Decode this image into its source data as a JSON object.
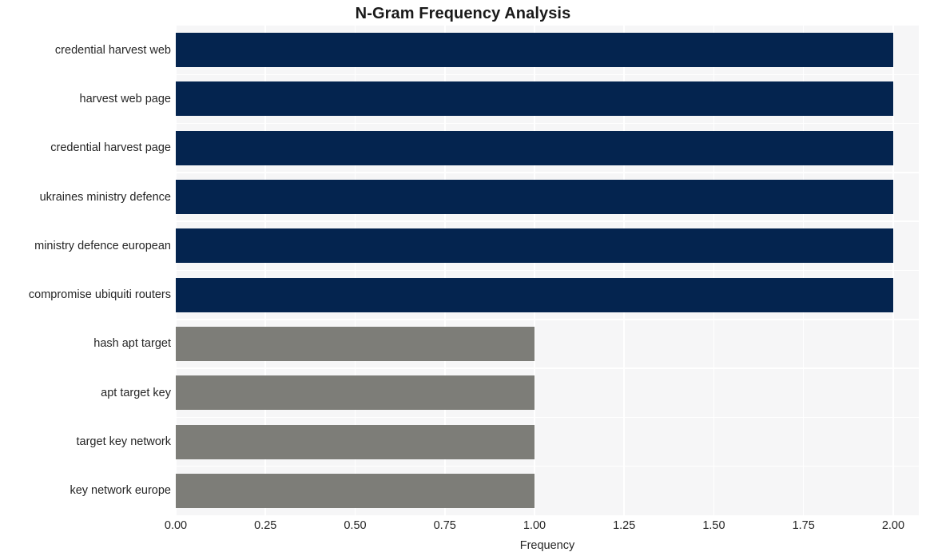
{
  "chart_data": {
    "type": "bar",
    "orientation": "horizontal",
    "title": "N-Gram Frequency Analysis",
    "xlabel": "Frequency",
    "ylabel": "",
    "categories": [
      "credential harvest web",
      "harvest web page",
      "credential harvest page",
      "ukraines ministry defence",
      "ministry defence european",
      "compromise ubiquiti routers",
      "hash apt target",
      "apt target key",
      "target key network",
      "key network europe"
    ],
    "values": [
      2,
      2,
      2,
      2,
      2,
      2,
      1,
      1,
      1,
      1
    ],
    "bar_colors": [
      "#04244f",
      "#04244f",
      "#04244f",
      "#04244f",
      "#04244f",
      "#04244f",
      "#7d7d78",
      "#7d7d78",
      "#7d7d78",
      "#7d7d78"
    ],
    "xlim": [
      0,
      2.0714
    ],
    "xticks": [
      0,
      0.25,
      0.5,
      0.75,
      1.0,
      1.25,
      1.5,
      1.75,
      2.0
    ],
    "xticklabels": [
      "0.00",
      "0.25",
      "0.50",
      "0.75",
      "1.00",
      "1.25",
      "1.50",
      "1.75",
      "2.00"
    ],
    "grid": true,
    "gridline_color": "#ffffff",
    "plot_background": "#f6f6f7",
    "figure_background": "#ffffff",
    "legend": null
  },
  "style": {
    "title_color": "#1a1a1a",
    "tick_label_color": "#262626",
    "axis_label_color": "#262626"
  }
}
